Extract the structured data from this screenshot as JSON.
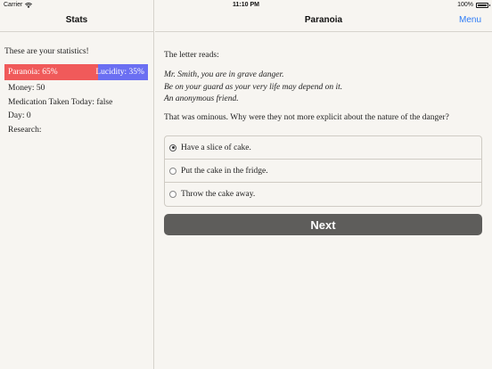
{
  "status_bar": {
    "carrier": "Carrier",
    "time": "11:10 PM",
    "battery": "100%"
  },
  "sidebar": {
    "title": "Stats",
    "intro": "These are your statistics!",
    "meter": {
      "paranoia_label": "Paranoia: 65%",
      "lucidity_label": "Lucidity: 35%",
      "paranoia_fraction": 0.65,
      "paranoia_color": "#f05a5a",
      "lucidity_color": "#6b6ff2"
    },
    "stats": {
      "money": "Money: 50",
      "medication": "Medication Taken Today: false",
      "day": "Day: 0",
      "research": "Research:"
    }
  },
  "main": {
    "title": "Paranoia",
    "menu_label": "Menu",
    "letter_intro": "The letter reads:",
    "letter_lines": [
      "Mr. Smith, you are in grave danger.",
      "Be on your guard as your very life may depend on it.",
      "An anonymous friend."
    ],
    "question": "That was ominous. Why were they not more explicit about the nature of the danger?",
    "options": [
      {
        "label": "Have a slice of cake.",
        "selected": true
      },
      {
        "label": "Put the cake in the fridge.",
        "selected": false
      },
      {
        "label": "Throw the cake away.",
        "selected": false
      }
    ],
    "next_label": "Next"
  }
}
